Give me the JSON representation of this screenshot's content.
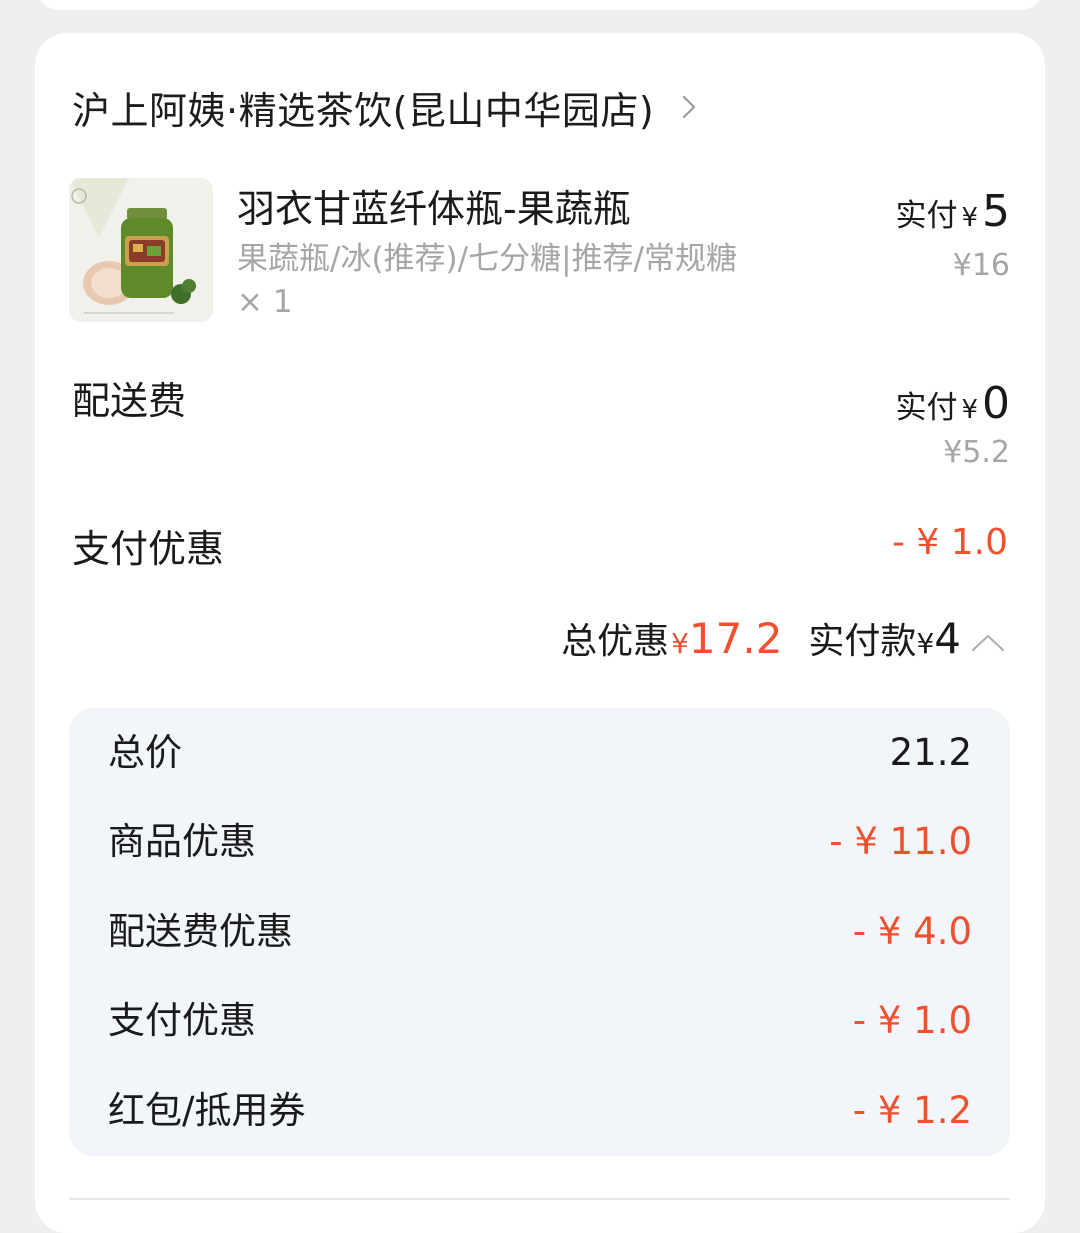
{
  "store": {
    "name": "沪上阿姨·精选茶饮(昆山中华园店)"
  },
  "product": {
    "title": "羽衣甘蓝纤体瓶-果蔬瓶",
    "spec": "果蔬瓶/冰(推荐)/七分糖|推荐/常规糖",
    "qty": "× 1",
    "paid_label": "实付",
    "yen": "¥",
    "paid_value": "5",
    "original": "¥16"
  },
  "delivery": {
    "label": "配送费",
    "paid_label": "实付",
    "yen": "¥",
    "paid_value": "0",
    "original": "¥5.2"
  },
  "payment_discount": {
    "label": "支付优惠",
    "value": "- ¥ 1.0"
  },
  "summary": {
    "total_discount_label": "总优惠",
    "yen": "¥",
    "total_discount_value": "17.2",
    "paid_label": "实付款",
    "paid_value": "4"
  },
  "breakdown": [
    {
      "label": "总价",
      "value": "21.2",
      "type": "neutral"
    },
    {
      "label": "商品优惠",
      "value": "- ¥ 11.0",
      "type": "red"
    },
    {
      "label": "配送费优惠",
      "value": "- ¥ 4.0",
      "type": "red"
    },
    {
      "label": "支付优惠",
      "value": "- ¥ 1.0",
      "type": "red"
    },
    {
      "label": "红包/抵用券",
      "value": "- ¥ 1.2",
      "type": "red"
    }
  ],
  "colors": {
    "accent_red": "#f0502e",
    "breakdown_bg": "#f2f5fa",
    "muted_text": "#a6a6a6"
  },
  "icons": {
    "store_chevron": "chevron-right-icon",
    "collapse": "chevron-up-icon"
  }
}
